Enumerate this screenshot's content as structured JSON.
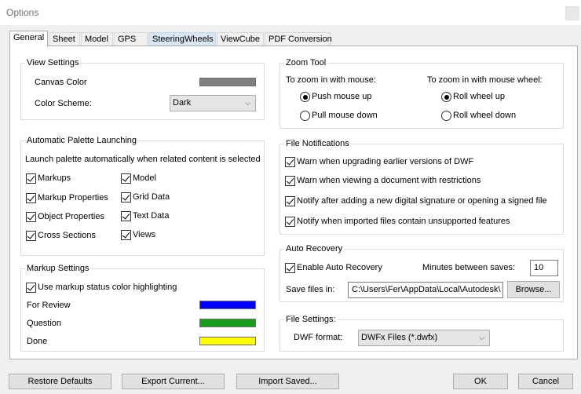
{
  "window": {
    "title": "Options"
  },
  "tabs": [
    {
      "label": "General"
    },
    {
      "label": "Sheet"
    },
    {
      "label": "Model"
    },
    {
      "label": "GPS"
    },
    {
      "label": "SteeringWheels"
    },
    {
      "label": "ViewCube"
    },
    {
      "label": "PDF Conversion"
    }
  ],
  "view_settings": {
    "title": "View Settings",
    "canvas_color_label": "Canvas Color",
    "canvas_color": "#808080",
    "color_scheme_label": "Color Scheme:",
    "color_scheme_value": "Dark"
  },
  "palette": {
    "title": "Automatic Palette Launching",
    "description": "Launch palette automatically when related content is selected",
    "items": [
      {
        "label": "Markups",
        "checked": true
      },
      {
        "label": "Markup Properties",
        "checked": true
      },
      {
        "label": "Object Properties",
        "checked": true
      },
      {
        "label": "Cross Sections",
        "checked": true
      },
      {
        "label": "Model",
        "checked": true
      },
      {
        "label": "Grid Data",
        "checked": true
      },
      {
        "label": "Text Data",
        "checked": true
      },
      {
        "label": "Views",
        "checked": true
      }
    ]
  },
  "markup_settings": {
    "title": "Markup Settings",
    "highlight_label": "Use markup status color highlighting",
    "statuses": [
      {
        "label": "For Review",
        "color": "#0000ff"
      },
      {
        "label": "Question",
        "color": "#1a9b1a"
      },
      {
        "label": "Done",
        "color": "#ffff00"
      }
    ]
  },
  "zoom_tool": {
    "title": "Zoom Tool",
    "mouse_label": "To zoom in with mouse:",
    "wheel_label": "To zoom in with mouse wheel:",
    "mouse_options": [
      {
        "label": "Push mouse up",
        "selected": true
      },
      {
        "label": "Pull mouse down",
        "selected": false
      }
    ],
    "wheel_options": [
      {
        "label": "Roll wheel up",
        "selected": true
      },
      {
        "label": "Roll wheel down",
        "selected": false
      }
    ]
  },
  "file_notifications": {
    "title": "File Notifications",
    "items": [
      {
        "label": "Warn when upgrading earlier versions of DWF",
        "checked": true
      },
      {
        "label": "Warn when viewing a document with restrictions",
        "checked": true
      },
      {
        "label": "Notify after adding a new digital signature or opening a signed file",
        "checked": true
      },
      {
        "label": "Notify when imported files contain unsupported features",
        "checked": true
      }
    ]
  },
  "auto_recovery": {
    "title": "Auto Recovery",
    "enable_label": "Enable Auto Recovery",
    "minutes_label": "Minutes between saves:",
    "minutes_value": "10",
    "save_label": "Save files in:",
    "save_path": "C:\\Users\\Fer\\AppData\\Local\\Autodesk\\",
    "browse_label": "Browse..."
  },
  "file_settings": {
    "title": "File Settings:",
    "format_label": "DWF format:",
    "format_value": "DWFx Files (*.dwfx)"
  },
  "buttons": {
    "restore": "Restore Defaults",
    "export": "Export Current...",
    "import": "Import Saved...",
    "ok": "OK",
    "cancel": "Cancel"
  }
}
